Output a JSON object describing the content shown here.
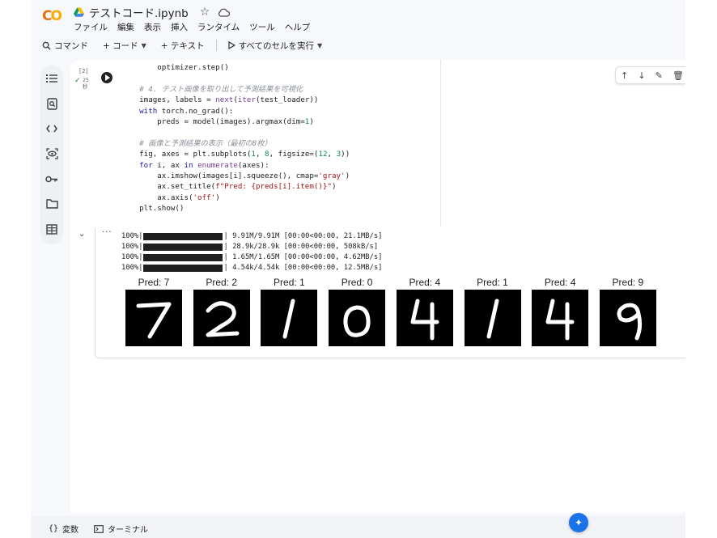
{
  "header": {
    "logo_letters": [
      "C",
      "O"
    ],
    "notebook_title": "テストコード.ipynb",
    "icons": [
      "drive-icon",
      "star-icon",
      "cloud-icon"
    ]
  },
  "menu": {
    "items": [
      "ファイル",
      "編集",
      "表示",
      "挿入",
      "ランタイム",
      "ツール",
      "ヘルプ"
    ]
  },
  "toolbar": {
    "command_label": "コマンド",
    "code_label": "+ コード",
    "text_label": "+ テキスト",
    "run_all_label": "すべてのセルを実行"
  },
  "sidebar": {
    "icons": [
      "toc-icon",
      "find-icon",
      "code-snippets-icon",
      "variables-inspector-icon",
      "secrets-key-icon",
      "files-folder-icon",
      "data-table-icon"
    ]
  },
  "cell": {
    "exec_count": "[2]",
    "exec_time": "25",
    "exec_time_unit": "秒",
    "tools": [
      "move-up-icon",
      "move-down-icon",
      "edit-icon",
      "delete-icon"
    ],
    "code_lines": [
      [
        {
          "t": "        optimizer.step()",
          "c": ""
        }
      ],
      [
        {
          "t": "",
          "c": ""
        }
      ],
      [
        {
          "t": "    # 4. テスト画像を取り出して予測結果を可視化",
          "c": "cm"
        }
      ],
      [
        {
          "t": "    images, labels = ",
          "c": ""
        },
        {
          "t": "next",
          "c": "fn"
        },
        {
          "t": "(",
          "c": ""
        },
        {
          "t": "iter",
          "c": "fn"
        },
        {
          "t": "(test_loader))",
          "c": ""
        }
      ],
      [
        {
          "t": "    with",
          "c": "kw"
        },
        {
          "t": " torch.no_grad():",
          "c": ""
        }
      ],
      [
        {
          "t": "        preds = model(images).argmax(dim=",
          "c": ""
        },
        {
          "t": "1",
          "c": "num"
        },
        {
          "t": ")",
          "c": ""
        }
      ],
      [
        {
          "t": "",
          "c": ""
        }
      ],
      [
        {
          "t": "    # 画像と予測結果の表示（最初の8枚）",
          "c": "cm"
        }
      ],
      [
        {
          "t": "    fig, axes = plt.subplots(",
          "c": ""
        },
        {
          "t": "1",
          "c": "num"
        },
        {
          "t": ", ",
          "c": ""
        },
        {
          "t": "8",
          "c": "num"
        },
        {
          "t": ", figsize=(",
          "c": ""
        },
        {
          "t": "12",
          "c": "num"
        },
        {
          "t": ", ",
          "c": ""
        },
        {
          "t": "3",
          "c": "num"
        },
        {
          "t": "))",
          "c": ""
        }
      ],
      [
        {
          "t": "    for",
          "c": "kw"
        },
        {
          "t": " i, ax ",
          "c": ""
        },
        {
          "t": "in",
          "c": "kw"
        },
        {
          "t": " ",
          "c": ""
        },
        {
          "t": "enumerate",
          "c": "fn"
        },
        {
          "t": "(axes):",
          "c": ""
        }
      ],
      [
        {
          "t": "        ax.imshow(images[i].squeeze(), cmap=",
          "c": ""
        },
        {
          "t": "'gray'",
          "c": "str"
        },
        {
          "t": ")",
          "c": ""
        }
      ],
      [
        {
          "t": "        ax.set_title(",
          "c": ""
        },
        {
          "t": "f\"Pred: {preds[i].item()}\"",
          "c": "str"
        },
        {
          "t": ")",
          "c": ""
        }
      ],
      [
        {
          "t": "        ax.axis(",
          "c": ""
        },
        {
          "t": "'off'",
          "c": "str"
        },
        {
          "t": ")",
          "c": ""
        }
      ],
      [
        {
          "t": "    plt.show()",
          "c": ""
        }
      ]
    ]
  },
  "output": {
    "progress": [
      {
        "pct": "100%",
        "stats": "9.91M/9.91M [00:00<00:00, 21.1MB/s]"
      },
      {
        "pct": "100%",
        "stats": "28.9k/28.9k [00:00<00:00, 508kB/s]"
      },
      {
        "pct": "100%",
        "stats": "1.65M/1.65M [00:00<00:00, 4.62MB/s]"
      },
      {
        "pct": "100%",
        "stats": "4.54k/4.54k [00:00<00:00, 12.5MB/s]"
      }
    ],
    "digits": [
      {
        "title": "Pred: 7",
        "digit": "7"
      },
      {
        "title": "Pred: 2",
        "digit": "2"
      },
      {
        "title": "Pred: 1",
        "digit": "1"
      },
      {
        "title": "Pred: 0",
        "digit": "0"
      },
      {
        "title": "Pred: 4",
        "digit": "4"
      },
      {
        "title": "Pred: 1",
        "digit": "1"
      },
      {
        "title": "Pred: 4",
        "digit": "4"
      },
      {
        "title": "Pred: 9",
        "digit": "9"
      }
    ]
  },
  "bottombar": {
    "variables_label": "変数",
    "terminal_label": "ターミナル"
  },
  "colors": {
    "accent_orange": "#e8710a",
    "accent_yellow": "#f9ab00",
    "success_green": "#188038",
    "gemini_blue": "#1a73e8"
  }
}
